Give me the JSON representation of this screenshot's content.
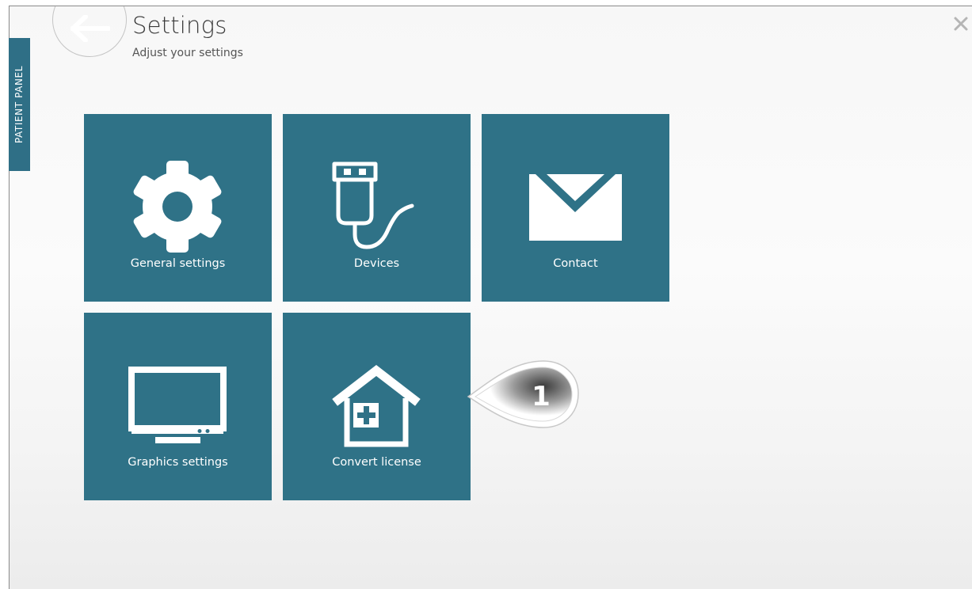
{
  "header": {
    "title": "Settings",
    "subtitle": "Adjust your settings"
  },
  "patient_panel": {
    "label": "PATIENT PANEL"
  },
  "tiles": [
    {
      "label": "General settings",
      "icon": "gear-icon"
    },
    {
      "label": "Devices",
      "icon": "usb-cable-icon"
    },
    {
      "label": "Contact",
      "icon": "envelope-icon"
    },
    {
      "label": "Graphics settings",
      "icon": "monitor-icon"
    },
    {
      "label": "Convert license",
      "icon": "house-plus-icon"
    }
  ],
  "callout": {
    "number": "1"
  },
  "icons": {
    "back": "back-arrow-icon",
    "close": "close-icon"
  },
  "colors": {
    "tile": "#2f7287",
    "tab": "#2f6f86",
    "text": "#3a3a3a"
  }
}
